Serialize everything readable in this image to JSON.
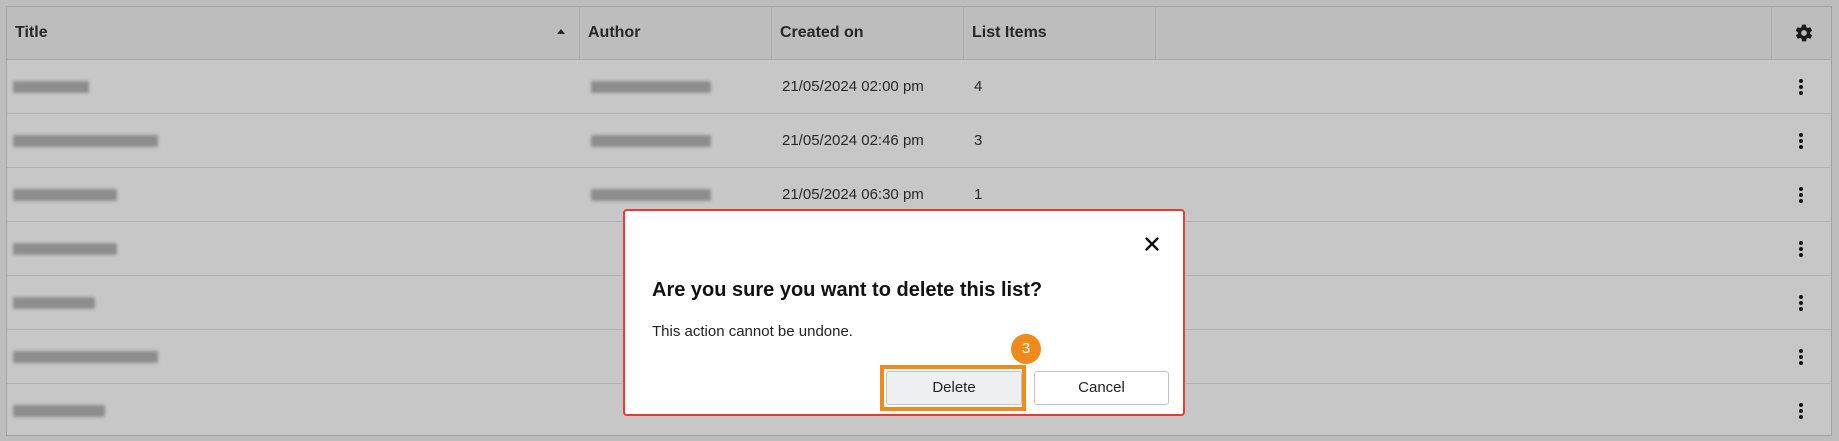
{
  "table": {
    "columns": [
      {
        "label": "Title",
        "sorted": "ascending"
      },
      {
        "label": "Author"
      },
      {
        "label": "Created on"
      },
      {
        "label": "List Items"
      }
    ],
    "settings_icon": "gear-icon",
    "rows": [
      {
        "created_on": "21/05/2024 02:00 pm",
        "list_items": "4"
      },
      {
        "created_on": "21/05/2024 02:46 pm",
        "list_items": "3"
      },
      {
        "created_on": "21/05/2024 06:30 pm",
        "list_items": "1"
      },
      {
        "created_on": "",
        "list_items": ""
      },
      {
        "created_on": "",
        "list_items": ""
      },
      {
        "created_on": "",
        "list_items": ""
      },
      {
        "created_on": "",
        "list_items": ""
      }
    ],
    "row_action_icon": "kebab-menu-icon"
  },
  "modal": {
    "title": "Are you sure you want to delete this list?",
    "message": "This action cannot be undone.",
    "delete_label": "Delete",
    "cancel_label": "Cancel",
    "close_icon": "close-icon",
    "step_badge": "3"
  },
  "colors": {
    "modal_border": "#e43b3b",
    "highlight": "#f08a1c",
    "header_bg": "#f2f2f2"
  }
}
